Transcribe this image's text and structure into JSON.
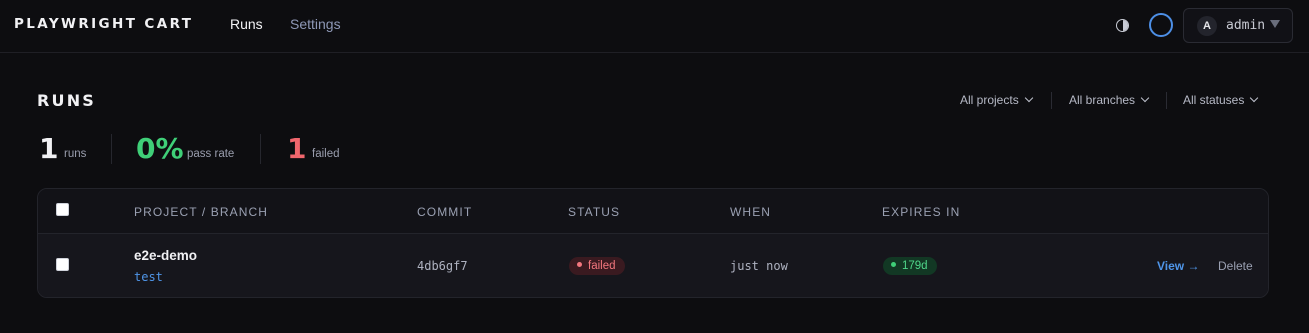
{
  "header": {
    "brand": "PLAYWRIGHT CART",
    "nav": {
      "runs": "Runs",
      "settings": "Settings"
    },
    "user": {
      "initial": "A",
      "name": "admin"
    },
    "icons": {
      "theme": "contrast-icon",
      "status": "ring-icon",
      "menu": "chevron-down-icon"
    }
  },
  "page": {
    "title": "RUNS",
    "filters": {
      "projects": "All projects",
      "branches": "All branches",
      "statuses": "All statuses"
    }
  },
  "stats": {
    "runs": {
      "value": "1",
      "label": "runs"
    },
    "pass_rate": {
      "value": "0%",
      "label": "pass rate"
    },
    "failed": {
      "value": "1",
      "label": "failed"
    }
  },
  "table": {
    "headers": {
      "project_branch": "PROJECT / BRANCH",
      "commit": "COMMIT",
      "status": "STATUS",
      "when": "WHEN",
      "expires_in": "EXPIRES IN"
    },
    "rows": [
      {
        "project": "e2e-demo",
        "branch": "test",
        "commit": "4db6gf7",
        "status": "failed",
        "when": "just now",
        "expires_in": "179d",
        "view": "View →",
        "delete": "Delete"
      }
    ]
  },
  "colors": {
    "accent": "#4f95e8",
    "pass": "#3fcf78",
    "fail": "#f0666d",
    "background": "#0d0d10"
  }
}
